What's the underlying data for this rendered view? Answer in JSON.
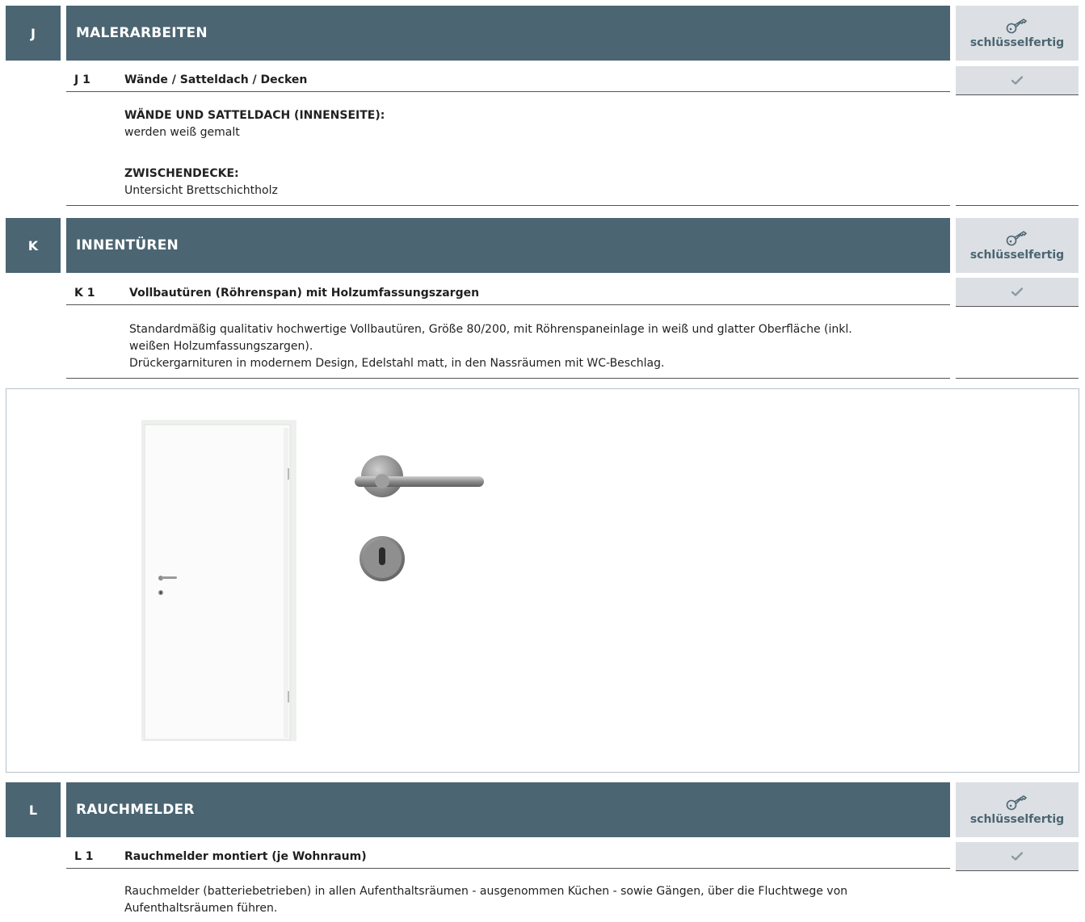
{
  "sections": {
    "j": {
      "letter": "J",
      "title": "MALERARBEITEN",
      "status_label": "schlüsselfertig",
      "item": {
        "code": "J 1",
        "title": "Wände / Satteldach / Decken"
      },
      "blocks": [
        {
          "heading": "WÄNDE UND SATTELDACH (INNENSEITE):",
          "text": "werden weiß gemalt"
        },
        {
          "heading": "ZWISCHENDECKE:",
          "text": "Untersicht Brettschichtholz"
        }
      ]
    },
    "k": {
      "letter": "K",
      "title": "INNENTÜREN",
      "status_label": "schlüsselfertig",
      "item": {
        "code": "K 1",
        "title": "Vollbautüren (Röhrenspan) mit Holzumfassungszargen"
      },
      "lines": [
        "Standardmäßig qualitativ hochwertige Vollbautüren, Größe 80/200, mit Röhrenspaneinlage in weiß und glatter Oberfläche (inkl.",
        "weißen Holzumfassungszargen).",
        "Drückergarnituren in modernem Design, Edelstahl matt, in den Nassräumen mit WC-Beschlag."
      ]
    },
    "l": {
      "letter": "L",
      "title": "RAUCHMELDER",
      "status_label": "schlüsselfertig",
      "item": {
        "code": "L 1",
        "title": "Rauchmelder montiert (je Wohnraum)"
      },
      "lines": [
        "Rauchmelder (batteriebetrieben) in allen Aufenthaltsräumen - ausgenommen Küchen - sowie Gängen, über die Fluchtwege von",
        "Aufenthaltsräumen führen."
      ]
    }
  },
  "icons": {
    "status": "key-icon",
    "included": "checkmark-icon"
  },
  "colors": {
    "header_bg": "#4b6572",
    "status_bg": "#dcdfe3",
    "check": "#8a9aa3"
  }
}
